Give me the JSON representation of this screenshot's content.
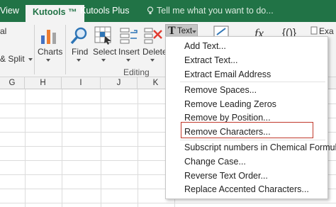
{
  "tabs": {
    "view": "View",
    "kutools": "Kutools ™",
    "kutools_plus": "Kutools Plus",
    "tell_me": "Tell me what you want to do..."
  },
  "ribbon": {
    "merge_split": "& Split",
    "charts": "Charts",
    "find": "Find",
    "select": "Select",
    "insert": "Insert",
    "delete": "Delete",
    "text": "Text",
    "formula_label": "fx",
    "brace_label": "{()}",
    "exa": "Exa",
    "editing_group": "Editing",
    "top_left_partial": "al"
  },
  "grid": {
    "columns": [
      "G",
      "H",
      "I",
      "J",
      "K"
    ]
  },
  "text_menu": {
    "items": [
      "Add Text...",
      "Extract Text...",
      "Extract Email Address",
      "Remove Spaces...",
      "Remove Leading Zeros",
      "Remove by Position...",
      "Remove Characters...",
      "Subscript numbers in Chemical Formulas",
      "Change Case...",
      "Reverse Text Order...",
      "Replace Accented Characters..."
    ],
    "highlighted_item": "Remove Characters..."
  },
  "colors": {
    "excel_green": "#217346",
    "highlight_border": "#c0392b"
  }
}
